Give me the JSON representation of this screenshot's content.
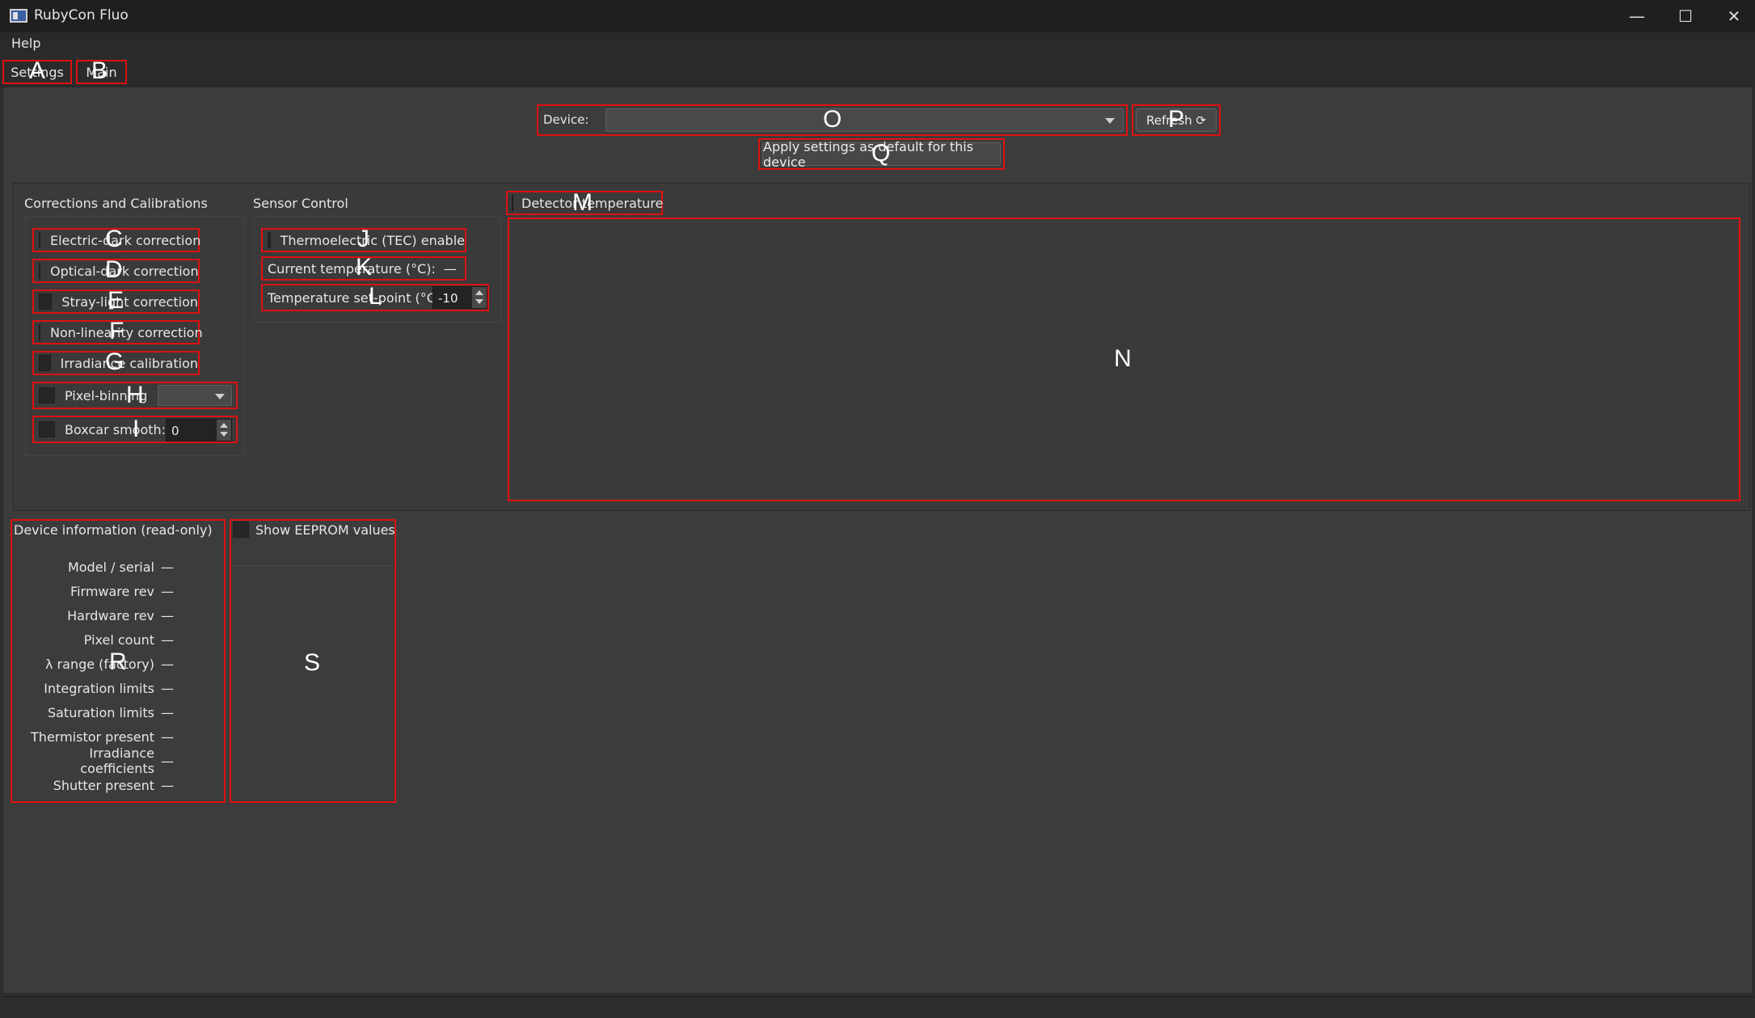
{
  "window": {
    "title": "RubyCon Fluo",
    "minimize_glyph": "—",
    "maximize_glyph": "☐",
    "close_glyph": "✕"
  },
  "menu": {
    "help": "Help"
  },
  "tabs": [
    {
      "label": "Settings",
      "marker": "A"
    },
    {
      "label": "Main",
      "marker": "B"
    }
  ],
  "device_bar": {
    "device_label": "Device:",
    "device_value": "",
    "device_marker": "O",
    "refresh_label": "Refresh ⟳",
    "refresh_marker": "P",
    "apply_default_label": "Apply settings as default for this device",
    "apply_marker": "Q"
  },
  "corrections": {
    "title": "Corrections and Calibrations",
    "items": [
      {
        "label": "Electric-dark correction",
        "marker": "C"
      },
      {
        "label": "Optical-dark correction",
        "marker": "D"
      },
      {
        "label": "Stray-light correction",
        "marker": "E"
      },
      {
        "label": "Non-linearity correction",
        "marker": "F"
      },
      {
        "label": "Irradiance calibration",
        "marker": "G"
      }
    ],
    "pixel_binning": {
      "label": "Pixel-binning",
      "value": "",
      "marker": "H"
    },
    "boxcar": {
      "label": "Boxcar smooth:",
      "value": "0",
      "marker": "I"
    }
  },
  "sensor_control": {
    "title": "Sensor Control",
    "tec_label": "Thermoelectric (TEC) enable",
    "tec_marker": "J",
    "current_temp_label": "Current temperature (°C):",
    "current_temp_value": "—",
    "current_temp_marker": "K",
    "setpoint_label": "Temperature set-point (°C):",
    "setpoint_value": "-10",
    "setpoint_marker": "L"
  },
  "detector_temperature": {
    "label": "Detector temperature",
    "marker": "M",
    "plot_marker": "N"
  },
  "device_info": {
    "title": "Device information (read-only)",
    "marker": "R",
    "rows": [
      {
        "key": "Model / serial",
        "value": "—"
      },
      {
        "key": "Firmware rev",
        "value": "—"
      },
      {
        "key": "Hardware rev",
        "value": "—"
      },
      {
        "key": "Pixel count",
        "value": "—"
      },
      {
        "key": "λ range (factory)",
        "value": "—"
      },
      {
        "key": "Integration limits",
        "value": "—"
      },
      {
        "key": "Saturation limits",
        "value": "—"
      },
      {
        "key": "Thermistor present",
        "value": "—"
      },
      {
        "key": "Irradiance coefficients",
        "value": "—"
      },
      {
        "key": "Shutter present",
        "value": "—"
      }
    ]
  },
  "eeprom": {
    "label": "Show EEPROM values",
    "marker": "S"
  },
  "colors": {
    "highlight": "#dd1111",
    "background": "#3c3c3c",
    "titlebar": "#1f1f1f"
  }
}
